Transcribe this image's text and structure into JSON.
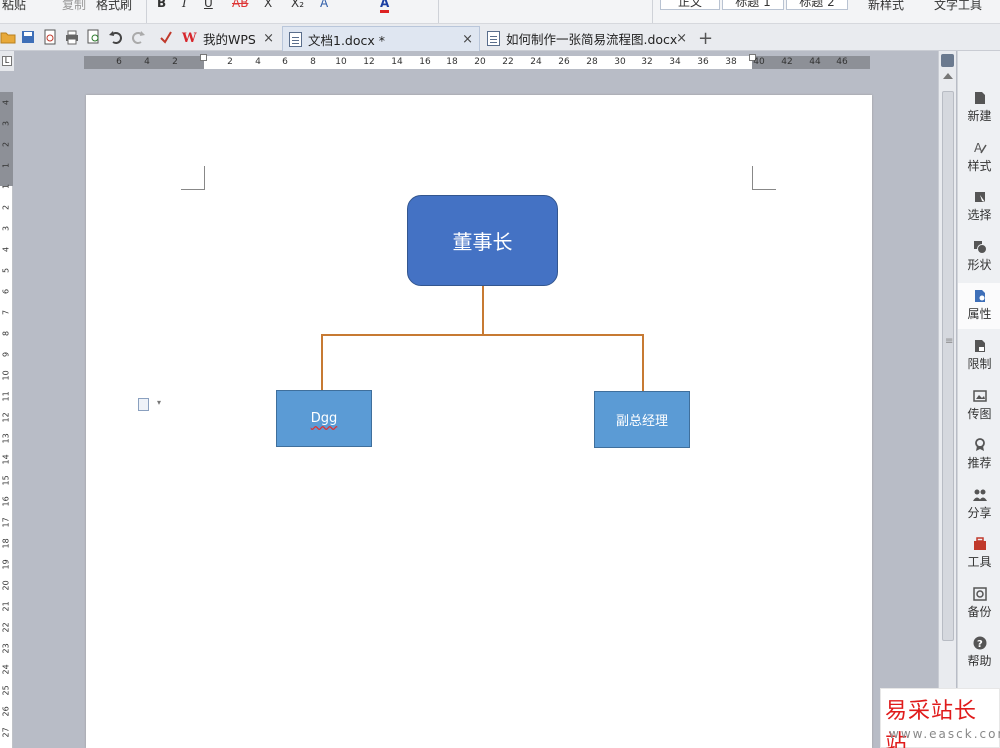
{
  "ribbon": {
    "items": [
      "粘贴",
      "复制",
      "格式刷",
      "B",
      "I",
      "U",
      "AB",
      "X",
      "X₂",
      "A",
      "A",
      "正文",
      "标题 1",
      "标题 2",
      "新样式",
      "文字工具"
    ]
  },
  "tabbar": {
    "tabs": [
      {
        "label": "我的WPS",
        "close": "×"
      },
      {
        "label": "文档1.docx *",
        "close": "×"
      },
      {
        "label": "如何制作一张简易流程图.docx",
        "close": "×"
      }
    ],
    "new_tab": "+"
  },
  "ruler": {
    "corner": "L",
    "h_numbers": [
      "6",
      "4",
      "2",
      "2",
      "4",
      "6",
      "8",
      "10",
      "12",
      "14",
      "16",
      "18",
      "20",
      "22",
      "24",
      "26",
      "28",
      "30",
      "32",
      "34",
      "36",
      "38",
      "40",
      "42",
      "44",
      "46"
    ],
    "v_numbers": [
      "4",
      "3",
      "2",
      "1",
      "1",
      "2",
      "3",
      "4",
      "5",
      "6",
      "7",
      "8",
      "9",
      "10",
      "11",
      "12",
      "13",
      "14",
      "15",
      "16",
      "17",
      "18",
      "19",
      "20",
      "21",
      "22",
      "23",
      "24",
      "25",
      "26",
      "27"
    ]
  },
  "flowchart": {
    "root": "董事长",
    "children": [
      "Dgg",
      "副总经理"
    ],
    "colors": {
      "root": "#4472c4",
      "child": "#5b9bd5",
      "connector": "#c77a33"
    }
  },
  "taskpane": {
    "items": [
      {
        "label": "新建",
        "icon": "new-doc-icon"
      },
      {
        "label": "样式",
        "icon": "style-icon"
      },
      {
        "label": "选择",
        "icon": "select-icon"
      },
      {
        "label": "形状",
        "icon": "shape-icon"
      },
      {
        "label": "属性",
        "icon": "properties-icon"
      },
      {
        "label": "限制",
        "icon": "restrict-icon"
      },
      {
        "label": "传图",
        "icon": "upload-image-icon"
      },
      {
        "label": "推荐",
        "icon": "recommend-icon"
      },
      {
        "label": "分享",
        "icon": "share-icon"
      },
      {
        "label": "工具",
        "icon": "toolbox-icon"
      },
      {
        "label": "备份",
        "icon": "backup-icon"
      },
      {
        "label": "帮助",
        "icon": "help-icon"
      }
    ],
    "selected": "属性"
  },
  "watermark": {
    "title": "易采站长站",
    "url": "www.easck.com"
  }
}
